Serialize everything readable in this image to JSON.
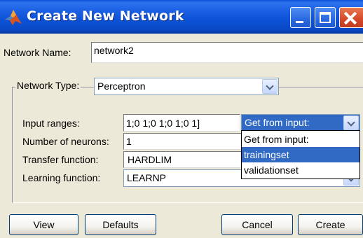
{
  "window": {
    "title": "Create New Network"
  },
  "network_name": {
    "label": "Network Name:",
    "value": "network2"
  },
  "network_type": {
    "label": "Network Type:",
    "value": "Perceptron"
  },
  "fields": {
    "input_ranges": {
      "label": "Input ranges:",
      "value": "1;0 1;0 1;0 1;0 1]"
    },
    "num_neurons": {
      "label": "Number of neurons:",
      "value": "1"
    },
    "transfer_function": {
      "label": "Transfer function:",
      "value": "HARDLIM"
    },
    "learning_function": {
      "label": "Learning function:",
      "value": "LEARNP"
    }
  },
  "input_source": {
    "selected": "Get from input:",
    "options": [
      "Get from input:",
      "trainingset",
      "validationset"
    ],
    "highlighted_index": 1
  },
  "buttons": {
    "view": "View",
    "defaults": "Defaults",
    "cancel": "Cancel",
    "create": "Create"
  },
  "colors": {
    "titlebar": "#0a4fd8",
    "dialog_bg": "#ece9d8",
    "selection": "#316ac5"
  }
}
